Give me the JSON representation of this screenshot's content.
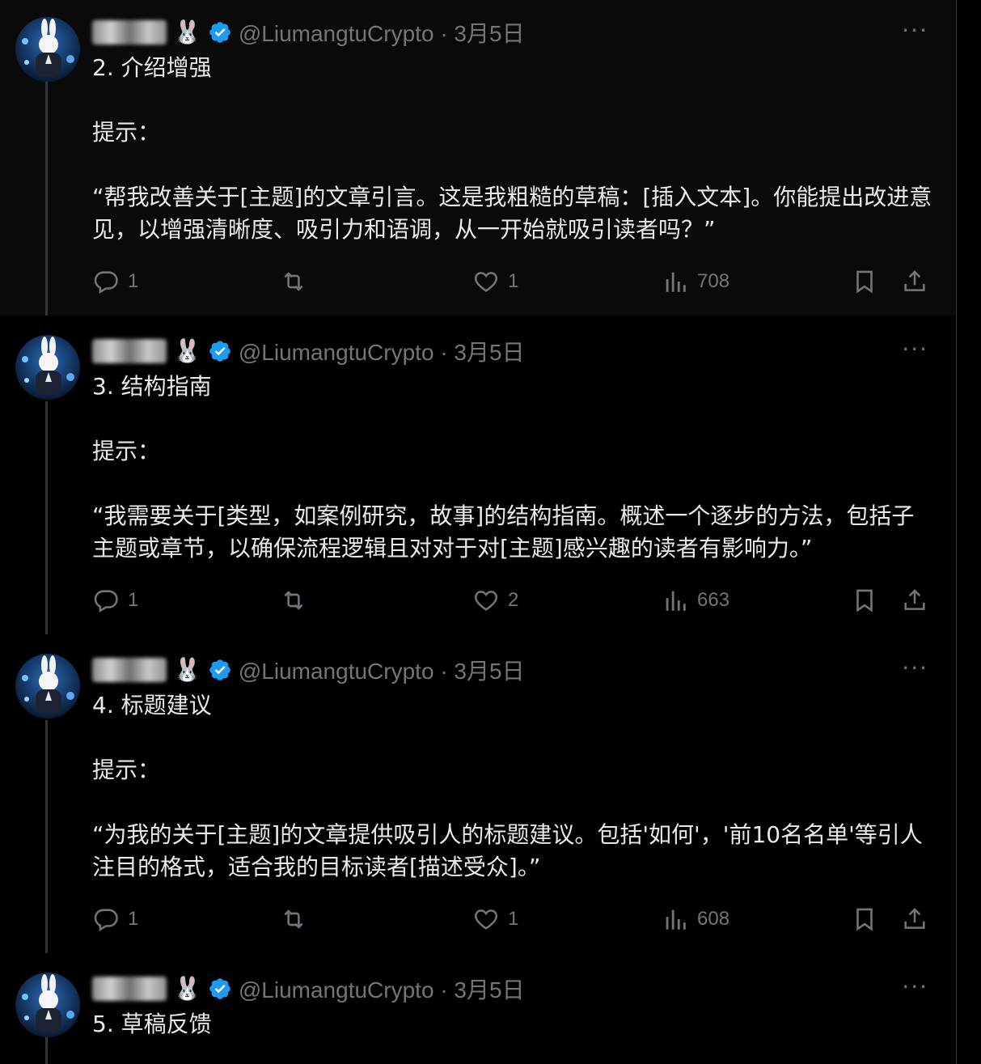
{
  "tweets": [
    {
      "name_suffix": "🐰",
      "handle": "@LiumangtuCrypto",
      "sep": "·",
      "date": "3月5日",
      "more": "···",
      "title": "2. 介绍增强",
      "prompt_label": "提示：",
      "body": "“帮我改善关于[主题]的文章引言。这是我粗糙的草稿：[插入文本]。你能提出改进意见，以增强清晰度、吸引力和语调，从一开始就吸引读者吗？”",
      "replies": "1",
      "retweets": "",
      "likes": "1",
      "views": "708"
    },
    {
      "name_suffix": "🐰",
      "handle": "@LiumangtuCrypto",
      "sep": "·",
      "date": "3月5日",
      "more": "···",
      "title": "3. 结构指南",
      "prompt_label": "提示：",
      "body": "“我需要关于[类型，如案例研究，故事]的结构指南。概述一个逐步的方法，包括子主题或章节，以确保流程逻辑且对对于对[主题]感兴趣的读者有影响力。”",
      "replies": "1",
      "retweets": "",
      "likes": "2",
      "views": "663"
    },
    {
      "name_suffix": "🐰",
      "handle": "@LiumangtuCrypto",
      "sep": "·",
      "date": "3月5日",
      "more": "···",
      "title": "4. 标题建议",
      "prompt_label": "提示：",
      "body": "“为我的关于[主题]的文章提供吸引人的标题建议。包括'如何'，'前10名名单'等引人注目的格式，适合我的目标读者[描述受众]。”",
      "replies": "1",
      "retweets": "",
      "likes": "1",
      "views": "608"
    },
    {
      "name_suffix": "🐰",
      "handle": "@LiumangtuCrypto",
      "sep": "·",
      "date": "3月5日",
      "more": "···",
      "title": "5. 草稿反馈"
    }
  ],
  "colors": {
    "background": "#000000",
    "text": "#e7e9ea",
    "muted": "#71767b",
    "verified": "#1d9bf0",
    "thread_line": "#333639"
  },
  "icons": [
    "reply-icon",
    "retweet-icon",
    "like-icon",
    "views-icon",
    "bookmark-icon",
    "share-icon",
    "verified-badge-icon",
    "more-icon"
  ]
}
